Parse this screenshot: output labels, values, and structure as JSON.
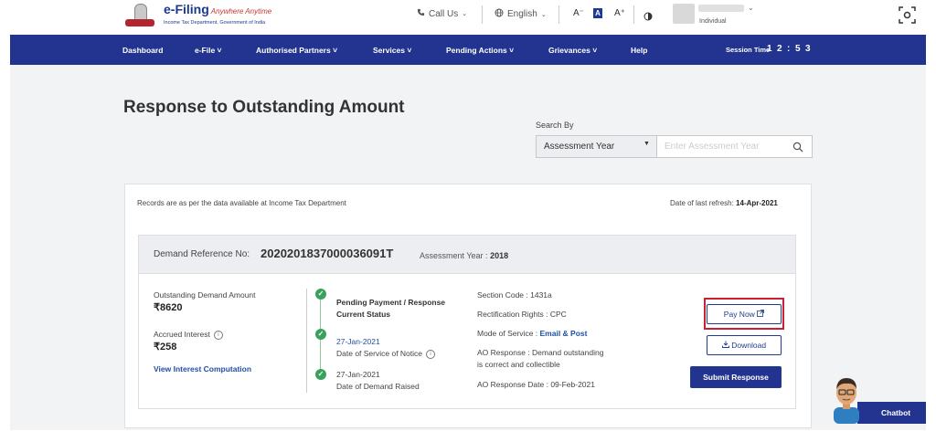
{
  "header": {
    "logo_main": "e-Filing",
    "logo_tagline": "Anywhere Anytime",
    "logo_sub": "Income Tax Department, Government of India",
    "call_us": "Call Us",
    "language": "English",
    "font_decrease": "A⁻",
    "font_default": "A",
    "font_increase": "A⁺",
    "user_role": "Individual"
  },
  "nav": {
    "items": [
      "Dashboard",
      "e-File ˅",
      "Authorised Partners ˅",
      "Services ˅",
      "Pending Actions ˅",
      "Grievances ˅",
      "Help"
    ],
    "session_label": "Session Time",
    "session_digits": [
      "1",
      "2",
      ":",
      "5",
      "3"
    ]
  },
  "page": {
    "title": "Response to Outstanding Amount",
    "search_by_label": "Search By",
    "search_select_value": "Assessment Year",
    "search_placeholder": "Enter Assessment Year"
  },
  "card": {
    "records_note": "Records are as per the data available at Income Tax Department",
    "refresh_label": "Date of last refresh:",
    "refresh_date": "14-Apr-2021",
    "demand_ref_label": "Demand Reference No:",
    "demand_ref_value": "2020201837000036091T",
    "ay_label": "Assessment Year :",
    "ay_value": "2018",
    "outstanding_label": "Outstanding Demand Amount",
    "outstanding_value": "₹8620",
    "accrued_label": "Accrued Interest",
    "accrued_value": "₹258",
    "interest_link": "View Interest Computation",
    "status_line1": "Pending Payment / Response",
    "status_line2": "Current Status",
    "notice_date": "27-Jan-2021",
    "notice_label": "Date of Service of Notice",
    "raised_date": "27-Jan-2021",
    "raised_label": "Date of Demand Raised",
    "section_code": "Section Code : 1431a",
    "rectification": "Rectification Rights : CPC",
    "mode_label": "Mode of Service :",
    "mode_value": "Email & Post",
    "ao_response_line1": "AO Response : Demand outstanding",
    "ao_response_line2": "is correct and collectible",
    "ao_date": "AO Response Date : 09-Feb-2021",
    "pay_now": "Pay Now",
    "download": "Download",
    "submit_response": "Submit Response"
  },
  "chatbot": {
    "label": "Chatbot"
  },
  "colors": {
    "nav_bg": "#22348f",
    "link": "#1f50a8",
    "success": "#3aa15b",
    "highlight": "#c8202e"
  }
}
